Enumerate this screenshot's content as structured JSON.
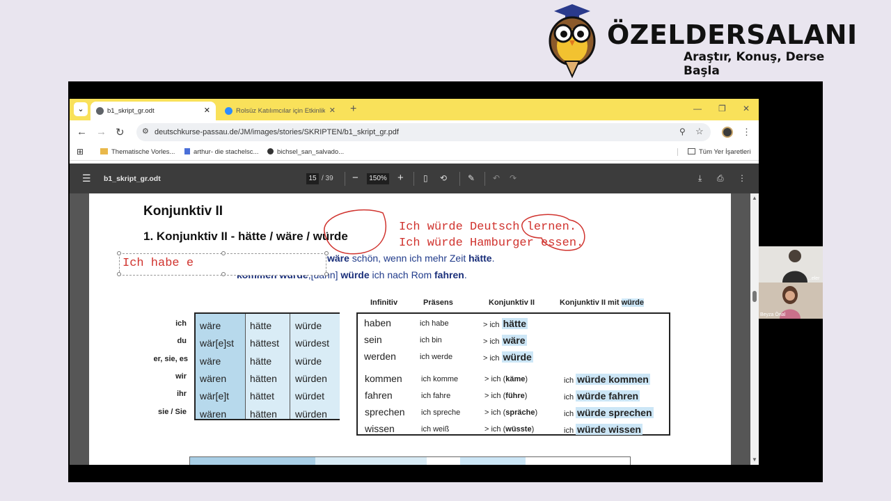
{
  "brand": {
    "name": "ÖZELDERSALANI",
    "tagline": "Araştır, Konuş, Derse Başla"
  },
  "browser": {
    "tabs": [
      {
        "label": "b1_skript_gr.odt",
        "active": true
      },
      {
        "label": "Rolsüz Katılımcılar için Etkinlik S",
        "active": false
      }
    ],
    "url": "deutschkurse-passau.de/JM/images/stories/SKRIPTEN/b1_skript_gr.pdf",
    "bookmarks": [
      "Thematische Vorles...",
      "arthur- die stachelsc...",
      "bichsel_san_salvado..."
    ],
    "all_bookmarks": "Tüm Yer İşaretleri"
  },
  "pdf": {
    "title": "b1_skript_gr.odt",
    "page": "15",
    "total": "/ 39",
    "zoom": "150%"
  },
  "doc": {
    "heading": "Konjunktiv II",
    "subheading": "1. Konjunktiv II - hätte / wäre / würde",
    "annotation_1": "Ich würde Deutsch lernen.",
    "annotation_2": "Ich würde Hamburger essen.",
    "textbox_value": "Ich habe e",
    "sentence_1": {
      "pre": "wäre",
      "mid": " schön, wenn ich mehr Zeit ",
      "post": "hätte",
      "end": "."
    },
    "sentence_2": {
      "a": "kommen würde",
      "b": ",[dann] ",
      "c": "würde",
      "d": " ich nach Rom ",
      "e": "fahren",
      "f": "."
    },
    "pronouns": [
      "ich",
      "du",
      "er, sie, es",
      "wir",
      "ihr",
      "sie / Sie"
    ],
    "conj_cols": [
      [
        "wäre",
        "wär[e]st",
        "wäre",
        "wären",
        "wär[e]t",
        "wären"
      ],
      [
        "hätte",
        "hättest",
        "hätte",
        "hätten",
        "hättet",
        "hätten"
      ],
      [
        "würde",
        "würdest",
        "würde",
        "würden",
        "würdet",
        "würden"
      ]
    ],
    "verb_headers": [
      "Infinitiv",
      "Präsens",
      "Konjunktiv II",
      "Konjunktiv II mit",
      "würde"
    ],
    "verbs_a": [
      {
        "inf": "haben",
        "pr": "ich habe",
        "k": "hätte"
      },
      {
        "inf": "sein",
        "pr": "ich bin",
        "k": "wäre"
      },
      {
        "inf": "werden",
        "pr": "ich werde",
        "k": "würde"
      }
    ],
    "verbs_b": [
      {
        "inf": "kommen",
        "pr": "ich komme",
        "k": "käme",
        "w": "würde kommen"
      },
      {
        "inf": "fahren",
        "pr": "ich fahre",
        "k": "führe",
        "w": "würde fahren"
      },
      {
        "inf": "sprechen",
        "pr": "ich spreche",
        "k": "spräche",
        "w": "würde sprechen"
      },
      {
        "inf": "wissen",
        "pr": "ich weiß",
        "k": "wüsste",
        "w": "würde wissen"
      }
    ],
    "arrow_ich": "> ich",
    "ich": "ich"
  },
  "participants": [
    {
      "name": "...eler"
    },
    {
      "name": "Beyza Önal"
    }
  ],
  "colors": {
    "tabbar": "#f9e15a",
    "accent_blue": "#1f3a8a",
    "annotation_red": "#d0332e",
    "table_blue": "#a9cfe6"
  }
}
